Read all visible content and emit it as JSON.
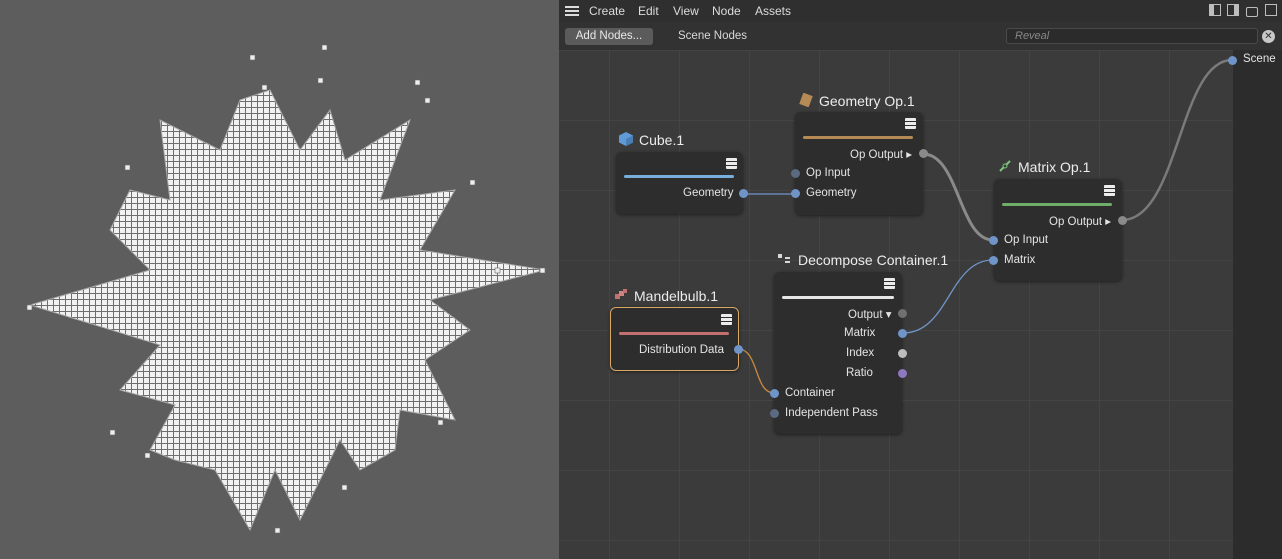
{
  "menu": {
    "items": [
      "Create",
      "Edit",
      "View",
      "Node",
      "Assets"
    ]
  },
  "toolbar": {
    "add_nodes": "Add Nodes...",
    "scene_nodes": "Scene Nodes",
    "search_placeholder": "Reveal"
  },
  "nodes": {
    "cube": {
      "title": "Cube.1",
      "color": "#78aedc",
      "output": "Geometry"
    },
    "geometry_op": {
      "title": "Geometry Op.1",
      "color": "#b58a55",
      "output": "Op Output ▸",
      "input1": "Op Input",
      "input2": "Geometry"
    },
    "matrix_op": {
      "title": "Matrix Op.1",
      "color": "#6fae6a",
      "output": "Op Output ▸",
      "input1": "Op Input",
      "input2": "Matrix"
    },
    "decompose": {
      "title": "Decompose Container.1",
      "color": "#e6e6e6",
      "output1": "Output ▾",
      "output2": "Matrix",
      "output3": "Index",
      "output4": "Ratio",
      "input1": "Container",
      "input2": "Independent Pass"
    },
    "mandelbulb": {
      "title": "Mandelbulb.1",
      "color": "#c27070",
      "output": "Distribution Data"
    }
  },
  "scene_port": "Scene"
}
